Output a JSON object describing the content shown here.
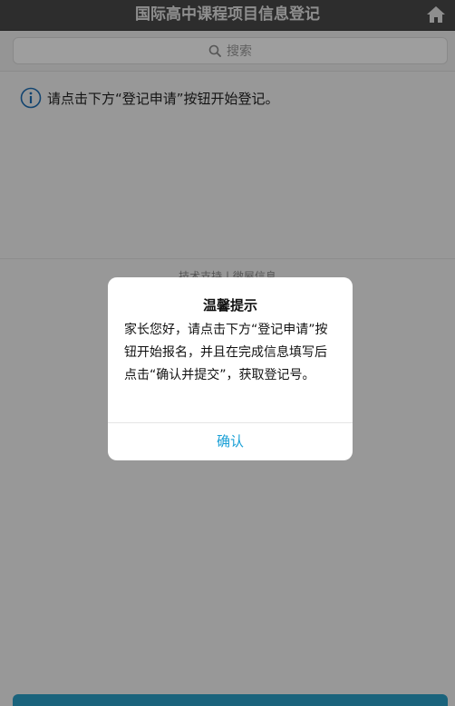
{
  "header": {
    "title": "国际高中课程项目信息登记",
    "home_icon": "home-icon"
  },
  "search": {
    "placeholder": "搜索",
    "icon": "search-icon"
  },
  "content": {
    "info_icon": "info-icon",
    "info_text": "请点击下方“登记申请”按钮开始登记。",
    "footer_text": "技术支持 | 微屋信息"
  },
  "dialog": {
    "title": "温馨提示",
    "message": "家长您好，请点击下方“登记申请”按钮开始报名，并且在完成信息填写后点击“确认并提交”，获取登记号。",
    "confirm_label": "确认"
  },
  "colors": {
    "header_bg": "#4a4a4a",
    "accent": "#1aa0d6",
    "bottom_button": "#2aa0c9"
  }
}
